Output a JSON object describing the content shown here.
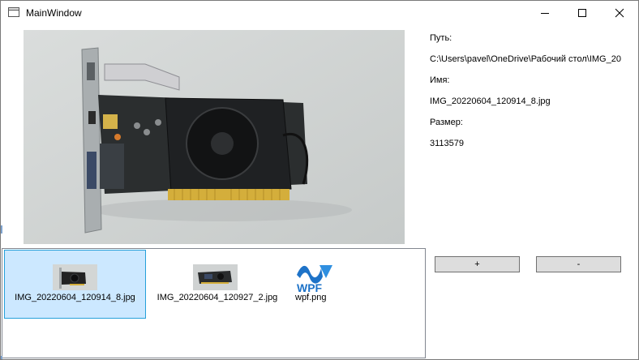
{
  "window": {
    "title": "MainWindow"
  },
  "details": {
    "path_label": "Путь:",
    "path_value": "C:\\Users\\pavel\\OneDrive\\Рабочий стол\\IMG_20",
    "name_label": "Имя:",
    "name_value": "IMG_20220604_120914_8.jpg",
    "size_label": "Размер:",
    "size_value": "3113579"
  },
  "buttons": {
    "plus": "+",
    "minus": "-"
  },
  "files": [
    {
      "name": "IMG_20220604_120914_8.jpg",
      "icon": "photo-thumbnail",
      "selected": true
    },
    {
      "name": "IMG_20220604_120927_2.jpg",
      "icon": "photo-thumbnail",
      "selected": false
    },
    {
      "name": "wpf.png",
      "icon": "wpf-logo",
      "selected": false
    }
  ],
  "wpf_logo_text": "WPF",
  "colors": {
    "selection_fill": "#cce8ff",
    "selection_border": "#26a0da",
    "wpf_blue": "#1e73c8"
  }
}
